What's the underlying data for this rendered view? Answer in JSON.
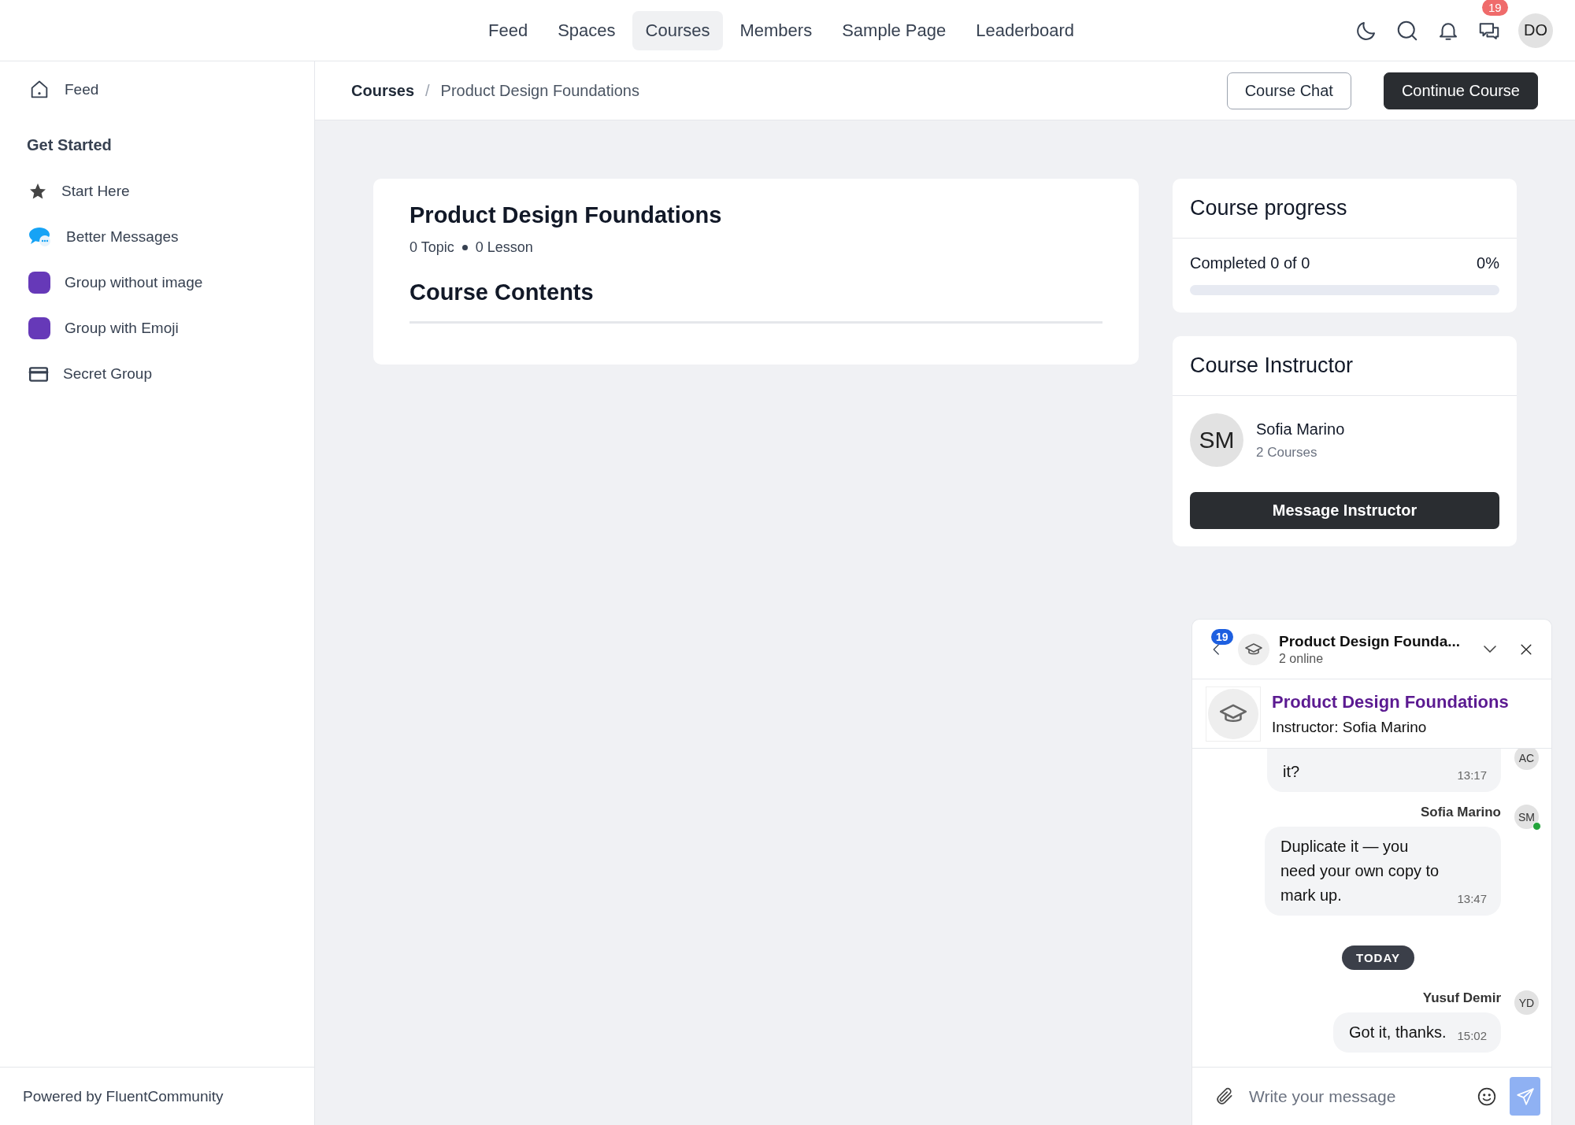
{
  "topnav": {
    "items": [
      {
        "label": "Feed",
        "selected": false
      },
      {
        "label": "Spaces",
        "selected": false
      },
      {
        "label": "Courses",
        "selected": true
      },
      {
        "label": "Members",
        "selected": false
      },
      {
        "label": "Sample Page",
        "selected": false
      },
      {
        "label": "Leaderboard",
        "selected": false
      }
    ],
    "chat_badge": "19",
    "avatar": "DO"
  },
  "sidebar": {
    "top_item": "Feed",
    "section": "Get Started",
    "items": [
      "Start Here",
      "Better Messages",
      "Group without image",
      "Group with Emoji",
      "Secret Group"
    ],
    "footer": "Powered by FluentCommunity"
  },
  "header": {
    "breadcrumb": [
      "Courses",
      "/",
      "Product Design Foundations"
    ],
    "buttons": [
      {
        "label": "Course Chat",
        "kind": "outline"
      },
      {
        "label": "Continue Course",
        "kind": "primary"
      }
    ]
  },
  "course": {
    "title": "Product Design Foundations",
    "topics": "0 Topic",
    "lessons": "0 Lesson",
    "contents_title": "Course Contents"
  },
  "progress": {
    "title": "Course progress",
    "label": "Completed 0 of 0",
    "percent": "0%",
    "level": 0
  },
  "instructor": {
    "title": "Course Instructor",
    "initials": "SM",
    "name": "Sofia Marino",
    "courses": "2 Courses",
    "button": "Message Instructor"
  },
  "chat": {
    "badge": "19",
    "title": "Product Design Founda...",
    "online": "2 online",
    "course_title": "Product Design Foundations",
    "course_instructor": "Instructor: Sofia Marino",
    "messages": [
      {
        "kind": "message",
        "text": "it?",
        "time": "13:17",
        "avatar": "AC",
        "online": false
      },
      {
        "kind": "message",
        "sender": "Sofia Marino",
        "text": "Duplicate it — you need your own copy to mark up.",
        "time": "13:47",
        "avatar": "SM",
        "online": true
      },
      {
        "kind": "divider",
        "text": "TODAY"
      },
      {
        "kind": "message",
        "sender": "Yusuf Demir",
        "text": "Got it, thanks.",
        "time": "15:02",
        "avatar": "YD",
        "online": false
      }
    ],
    "input": {
      "placeholder": "Write your message"
    }
  }
}
